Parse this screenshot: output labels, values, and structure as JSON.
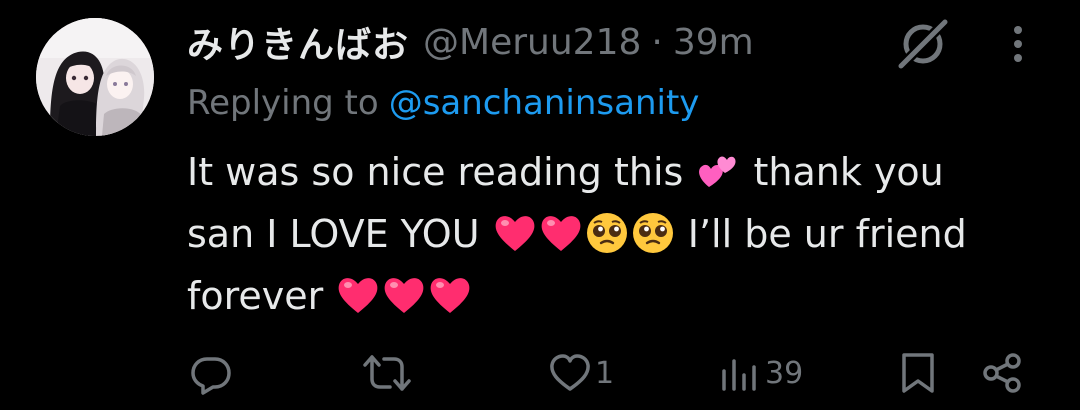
{
  "author": {
    "display_name": "みりきんばお",
    "handle": "@Meruu218",
    "separator": "·",
    "time": "39m"
  },
  "reply": {
    "prefix": "Replying to",
    "mention": "@sanchaninsanity"
  },
  "body": {
    "line1_a": "It was so nice reading this",
    "line1_emoji": "💕",
    "line1_b": "thank you",
    "line2_a": "san I LOVE YOU",
    "line2_emojis": "❤️❤️🥹🥹",
    "line2_b": "I’ll be ur friend",
    "line3_a": "forever",
    "line3_emojis": "❤️❤️❤️"
  },
  "actions": {
    "reply_count": "",
    "retweet_count": "",
    "like_count": "1",
    "view_count": "39"
  },
  "icons": {
    "top_right": [
      "grok-icon",
      "more-vertical-icon"
    ],
    "action_bar": [
      "reply-icon",
      "retweet-icon",
      "like-icon",
      "views-icon",
      "bookmark-icon",
      "share-icon"
    ]
  },
  "colors": {
    "background": "#000000",
    "text_primary": "#e7e9ea",
    "text_secondary": "#71767b",
    "link": "#1d9bf0",
    "heart": "#ff2d6f"
  }
}
